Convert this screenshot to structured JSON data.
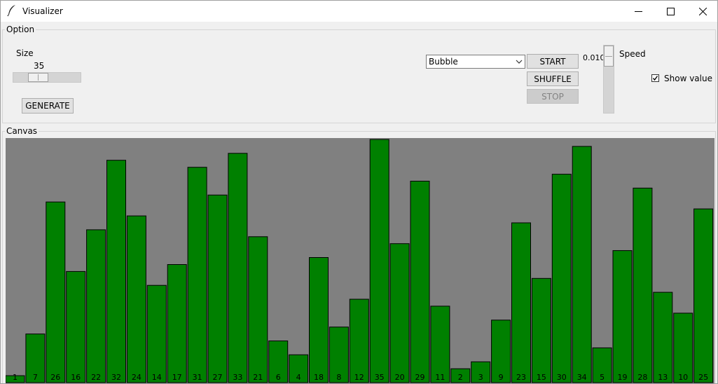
{
  "window": {
    "title": "Visualizer"
  },
  "option": {
    "legend": "Option",
    "size_label": "Size",
    "size_value": "35",
    "generate_label": "GENERATE",
    "algorithm_selected": "Bubble",
    "start_label": "START",
    "shuffle_label": "SHUFFLE",
    "stop_label": "STOP",
    "speed_value": "0.010",
    "speed_label": "Speed",
    "show_value_label": "Show value",
    "show_value_checked": true
  },
  "canvas": {
    "legend": "Canvas"
  },
  "icons": {
    "app": "feather-icon",
    "minimize": "minimize-icon",
    "maximize": "maximize-icon",
    "close": "close-icon",
    "dropdown": "chevron-down-icon",
    "check": "checkmark-icon"
  },
  "colors": {
    "bar": "#008000",
    "plot_bg": "#808080"
  },
  "chart_data": {
    "type": "bar",
    "values": [
      1,
      7,
      26,
      16,
      22,
      32,
      24,
      14,
      17,
      31,
      27,
      33,
      21,
      6,
      4,
      18,
      8,
      12,
      35,
      20,
      29,
      11,
      2,
      3,
      9,
      23,
      15,
      30,
      34,
      5,
      19,
      28,
      13,
      10,
      25
    ],
    "labels": [
      "1",
      "7",
      "26",
      "16",
      "22",
      "32",
      "24",
      "14",
      "17",
      "31",
      "27",
      "33",
      "21",
      "6",
      "4",
      "18",
      "8",
      "12",
      "35",
      "20",
      "29",
      "11",
      "2",
      "3",
      "9",
      "23",
      "15",
      "30",
      "34",
      "5",
      "19",
      "28",
      "13",
      "10",
      "25"
    ],
    "ylim": [
      0,
      35
    ],
    "grid": false
  }
}
